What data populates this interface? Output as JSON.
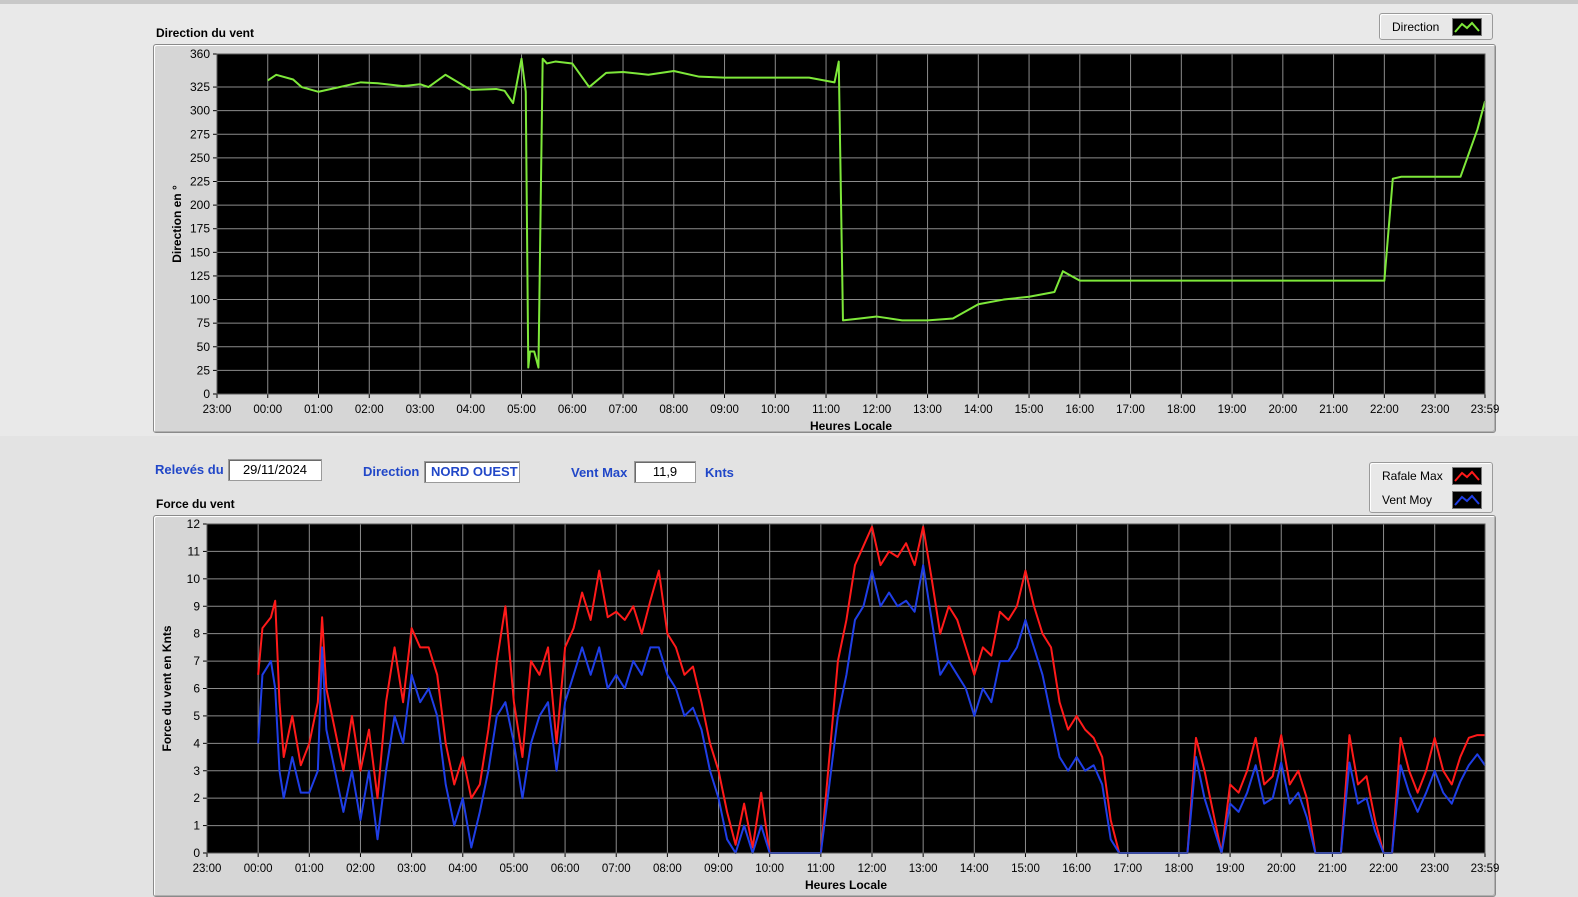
{
  "header": {
    "releves_label": "Relevés du",
    "date_value": "29/11/2024",
    "direction_label": "Direction",
    "direction_value": "NORD OUEST",
    "ventmax_label": "Vent Max",
    "ventmax_value": "11,9",
    "ventmax_unit": "Knts"
  },
  "colors": {
    "direction": "#7ee83a",
    "rafale": "#ff1a1a",
    "ventmoy": "#1f3ee6",
    "plot_bg": "#000000",
    "grid": "#8c8c8c"
  },
  "chart_data": [
    {
      "id": "direction",
      "type": "line",
      "title": "Direction du vent",
      "xlabel": "Heures Locale",
      "ylabel": "Direction en °",
      "x_ticks": [
        "23:00",
        "00:00",
        "01:00",
        "02:00",
        "03:00",
        "04:00",
        "05:00",
        "06:00",
        "07:00",
        "08:00",
        "09:00",
        "10:00",
        "11:00",
        "12:00",
        "13:00",
        "14:00",
        "15:00",
        "16:00",
        "17:00",
        "18:00",
        "19:00",
        "20:00",
        "21:00",
        "22:00",
        "23:00",
        "23:59"
      ],
      "xlim": [
        "23:00",
        "23:59"
      ],
      "y_ticks": [
        0,
        25,
        50,
        75,
        100,
        125,
        150,
        175,
        200,
        225,
        250,
        275,
        300,
        325,
        360
      ],
      "ylim": [
        0,
        360
      ],
      "grid": true,
      "legend": "top-right",
      "series": [
        {
          "name": "Direction",
          "x": [
            "00:00",
            "00:10",
            "00:30",
            "00:40",
            "01:00",
            "01:10",
            "01:50",
            "02:10",
            "02:40",
            "03:00",
            "03:10",
            "03:30",
            "04:00",
            "04:30",
            "04:40",
            "04:50",
            "05:00",
            "05:05",
            "05:08",
            "05:10",
            "05:15",
            "05:20",
            "05:25",
            "05:30",
            "05:40",
            "06:00",
            "06:20",
            "06:40",
            "07:00",
            "07:30",
            "08:00",
            "08:30",
            "09:00",
            "10:00",
            "10:40",
            "11:10",
            "11:15",
            "11:20",
            "11:40",
            "12:00",
            "12:30",
            "13:00",
            "13:30",
            "14:00",
            "14:30",
            "15:00",
            "15:30",
            "15:40",
            "15:50",
            "16:00",
            "17:00",
            "18:00",
            "19:00",
            "20:00",
            "21:00",
            "22:00",
            "22:10",
            "22:20",
            "22:30",
            "23:00",
            "23:30",
            "23:40",
            "23:50",
            "23:59"
          ],
          "y": [
            332,
            338,
            333,
            325,
            320,
            322,
            330,
            329,
            326,
            328,
            325,
            338,
            322,
            323,
            321,
            308,
            355,
            320,
            28,
            45,
            45,
            28,
            355,
            350,
            352,
            350,
            325,
            340,
            341,
            338,
            342,
            336,
            335,
            335,
            335,
            330,
            352,
            78,
            80,
            82,
            78,
            78,
            80,
            95,
            100,
            103,
            108,
            130,
            125,
            120,
            120,
            120,
            120,
            120,
            120,
            120,
            228,
            230,
            230,
            230,
            230,
            255,
            280,
            310
          ]
        }
      ]
    },
    {
      "id": "force",
      "type": "line",
      "title": "Force du vent",
      "xlabel": "Heures Locale",
      "ylabel": "Force du vent en Knts",
      "x_ticks": [
        "23:00",
        "00:00",
        "01:00",
        "02:00",
        "03:00",
        "04:00",
        "05:00",
        "06:00",
        "07:00",
        "08:00",
        "09:00",
        "10:00",
        "11:00",
        "12:00",
        "13:00",
        "14:00",
        "15:00",
        "16:00",
        "17:00",
        "18:00",
        "19:00",
        "20:00",
        "21:00",
        "22:00",
        "23:00",
        "23:59"
      ],
      "xlim": [
        "23:00",
        "23:59"
      ],
      "y_ticks": [
        0,
        1,
        2,
        3,
        4,
        5,
        6,
        7,
        8,
        9,
        10,
        11,
        12
      ],
      "ylim": [
        0,
        12
      ],
      "grid": true,
      "legend": "top-right",
      "series": [
        {
          "name": "Rafale Max",
          "x": [
            "00:00",
            "00:05",
            "00:15",
            "00:20",
            "00:25",
            "00:30",
            "00:40",
            "00:50",
            "01:00",
            "01:10",
            "01:15",
            "01:20",
            "01:30",
            "01:40",
            "01:50",
            "02:00",
            "02:10",
            "02:20",
            "02:30",
            "02:40",
            "02:50",
            "03:00",
            "03:10",
            "03:20",
            "03:30",
            "03:40",
            "03:50",
            "04:00",
            "04:10",
            "04:20",
            "04:30",
            "04:40",
            "04:50",
            "05:00",
            "05:10",
            "05:20",
            "05:30",
            "05:40",
            "05:50",
            "06:00",
            "06:10",
            "06:20",
            "06:30",
            "06:40",
            "06:50",
            "07:00",
            "07:10",
            "07:20",
            "07:30",
            "07:40",
            "07:50",
            "08:00",
            "08:10",
            "08:20",
            "08:30",
            "08:40",
            "08:50",
            "09:00",
            "09:10",
            "09:20",
            "09:30",
            "09:40",
            "09:50",
            "10:00",
            "10:10",
            "10:20",
            "11:00",
            "11:20",
            "11:30",
            "11:40",
            "11:50",
            "12:00",
            "12:10",
            "12:20",
            "12:30",
            "12:40",
            "12:50",
            "13:00",
            "13:10",
            "13:20",
            "13:30",
            "13:40",
            "13:50",
            "14:00",
            "14:10",
            "14:20",
            "14:30",
            "14:40",
            "14:50",
            "15:00",
            "15:10",
            "15:20",
            "15:30",
            "15:40",
            "15:50",
            "16:00",
            "16:10",
            "16:20",
            "16:30",
            "16:40",
            "16:50",
            "17:00",
            "18:00",
            "18:10",
            "18:20",
            "18:30",
            "18:40",
            "18:50",
            "19:00",
            "19:10",
            "19:20",
            "19:30",
            "19:40",
            "19:50",
            "20:00",
            "20:10",
            "20:20",
            "20:30",
            "20:40",
            "21:00",
            "21:10",
            "21:20",
            "21:30",
            "21:40",
            "21:50",
            "22:00",
            "22:10",
            "22:20",
            "22:30",
            "22:40",
            "22:50",
            "23:00",
            "23:10",
            "23:20",
            "23:30",
            "23:40",
            "23:50",
            "23:59"
          ],
          "y": [
            6.5,
            8.2,
            8.6,
            9.2,
            5.5,
            3.5,
            5.0,
            3.2,
            4.0,
            5.5,
            8.6,
            6.0,
            4.5,
            3.0,
            5.0,
            3.0,
            4.5,
            2.0,
            5.5,
            7.5,
            5.5,
            8.2,
            7.5,
            7.5,
            6.5,
            4.0,
            2.5,
            3.5,
            2.0,
            2.5,
            4.5,
            7.0,
            9.0,
            5.5,
            3.5,
            7.0,
            6.5,
            7.5,
            4.0,
            7.5,
            8.2,
            9.5,
            8.5,
            10.3,
            8.6,
            8.8,
            8.5,
            9.0,
            8.0,
            9.2,
            10.3,
            8.0,
            7.5,
            6.5,
            6.8,
            5.5,
            4.0,
            3.0,
            1.5,
            0.3,
            1.8,
            0.2,
            2.2,
            0.0,
            0.0,
            0.0,
            0.0,
            7.0,
            8.5,
            10.5,
            11.2,
            11.9,
            10.5,
            11.0,
            10.8,
            11.3,
            10.5,
            11.9,
            10.0,
            8.0,
            9.0,
            8.5,
            7.5,
            6.5,
            7.5,
            7.2,
            8.8,
            8.5,
            9.0,
            10.3,
            9.0,
            8.0,
            7.5,
            5.5,
            4.5,
            5.0,
            4.5,
            4.2,
            3.5,
            1.2,
            0.0,
            0.0,
            0.0,
            0.0,
            4.2,
            3.0,
            1.5,
            0.0,
            2.5,
            2.2,
            3.0,
            4.2,
            2.5,
            2.8,
            4.3,
            2.5,
            3.0,
            2.0,
            0.0,
            0.0,
            0.0,
            4.3,
            2.5,
            2.8,
            1.2,
            0.0,
            0.0,
            4.2,
            3.0,
            2.2,
            3.0,
            4.2,
            3.0,
            2.5,
            3.5,
            4.2,
            4.3,
            4.3
          ]
        },
        {
          "name": "Vent Moy",
          "x": [
            "00:00",
            "00:05",
            "00:15",
            "00:20",
            "00:25",
            "00:30",
            "00:40",
            "00:50",
            "01:00",
            "01:10",
            "01:15",
            "01:20",
            "01:30",
            "01:40",
            "01:50",
            "02:00",
            "02:10",
            "02:20",
            "02:30",
            "02:40",
            "02:50",
            "03:00",
            "03:10",
            "03:20",
            "03:30",
            "03:40",
            "03:50",
            "04:00",
            "04:10",
            "04:20",
            "04:30",
            "04:40",
            "04:50",
            "05:00",
            "05:10",
            "05:20",
            "05:30",
            "05:40",
            "05:50",
            "06:00",
            "06:10",
            "06:20",
            "06:30",
            "06:40",
            "06:50",
            "07:00",
            "07:10",
            "07:20",
            "07:30",
            "07:40",
            "07:50",
            "08:00",
            "08:10",
            "08:20",
            "08:30",
            "08:40",
            "08:50",
            "09:00",
            "09:10",
            "09:20",
            "09:30",
            "09:40",
            "09:50",
            "10:00",
            "10:10",
            "10:20",
            "11:00",
            "11:20",
            "11:30",
            "11:40",
            "11:50",
            "12:00",
            "12:10",
            "12:20",
            "12:30",
            "12:40",
            "12:50",
            "13:00",
            "13:10",
            "13:20",
            "13:30",
            "13:40",
            "13:50",
            "14:00",
            "14:10",
            "14:20",
            "14:30",
            "14:40",
            "14:50",
            "15:00",
            "15:10",
            "15:20",
            "15:30",
            "15:40",
            "15:50",
            "16:00",
            "16:10",
            "16:20",
            "16:30",
            "16:40",
            "16:50",
            "17:00",
            "18:00",
            "18:10",
            "18:20",
            "18:30",
            "18:40",
            "18:50",
            "19:00",
            "19:10",
            "19:20",
            "19:30",
            "19:40",
            "19:50",
            "20:00",
            "20:10",
            "20:20",
            "20:30",
            "20:40",
            "21:00",
            "21:10",
            "21:20",
            "21:30",
            "21:40",
            "21:50",
            "22:00",
            "22:10",
            "22:20",
            "22:30",
            "22:40",
            "22:50",
            "23:00",
            "23:10",
            "23:20",
            "23:30",
            "23:40",
            "23:50",
            "23:59"
          ],
          "y": [
            4.0,
            6.5,
            7.0,
            6.0,
            3.0,
            2.0,
            3.5,
            2.2,
            2.2,
            3.0,
            7.5,
            4.5,
            3.0,
            1.5,
            3.0,
            1.2,
            3.0,
            0.5,
            3.0,
            5.0,
            4.0,
            6.5,
            5.5,
            6.0,
            5.0,
            2.5,
            1.0,
            2.0,
            0.2,
            1.5,
            3.0,
            5.0,
            5.5,
            4.0,
            2.0,
            4.0,
            5.0,
            5.5,
            3.0,
            5.5,
            6.5,
            7.5,
            6.5,
            7.5,
            6.0,
            6.5,
            6.0,
            7.0,
            6.5,
            7.5,
            7.5,
            6.5,
            6.0,
            5.0,
            5.3,
            4.5,
            3.0,
            2.0,
            0.5,
            0.0,
            1.0,
            0.0,
            1.0,
            0.0,
            0.0,
            0.0,
            0.0,
            5.0,
            6.5,
            8.5,
            9.0,
            10.3,
            9.0,
            9.5,
            9.0,
            9.2,
            8.8,
            10.5,
            8.5,
            6.5,
            7.0,
            6.5,
            6.0,
            5.0,
            6.0,
            5.5,
            7.0,
            7.0,
            7.5,
            8.5,
            7.5,
            6.5,
            5.0,
            3.5,
            3.0,
            3.5,
            3.0,
            3.2,
            2.5,
            0.5,
            0.0,
            0.0,
            0.0,
            0.0,
            3.5,
            2.0,
            1.0,
            0.0,
            1.8,
            1.5,
            2.2,
            3.2,
            1.8,
            2.0,
            3.3,
            1.8,
            2.2,
            1.3,
            0.0,
            0.0,
            0.0,
            3.3,
            1.8,
            2.0,
            0.8,
            0.0,
            0.0,
            3.2,
            2.2,
            1.5,
            2.2,
            3.0,
            2.2,
            1.8,
            2.6,
            3.2,
            3.6,
            3.2
          ]
        }
      ]
    }
  ]
}
